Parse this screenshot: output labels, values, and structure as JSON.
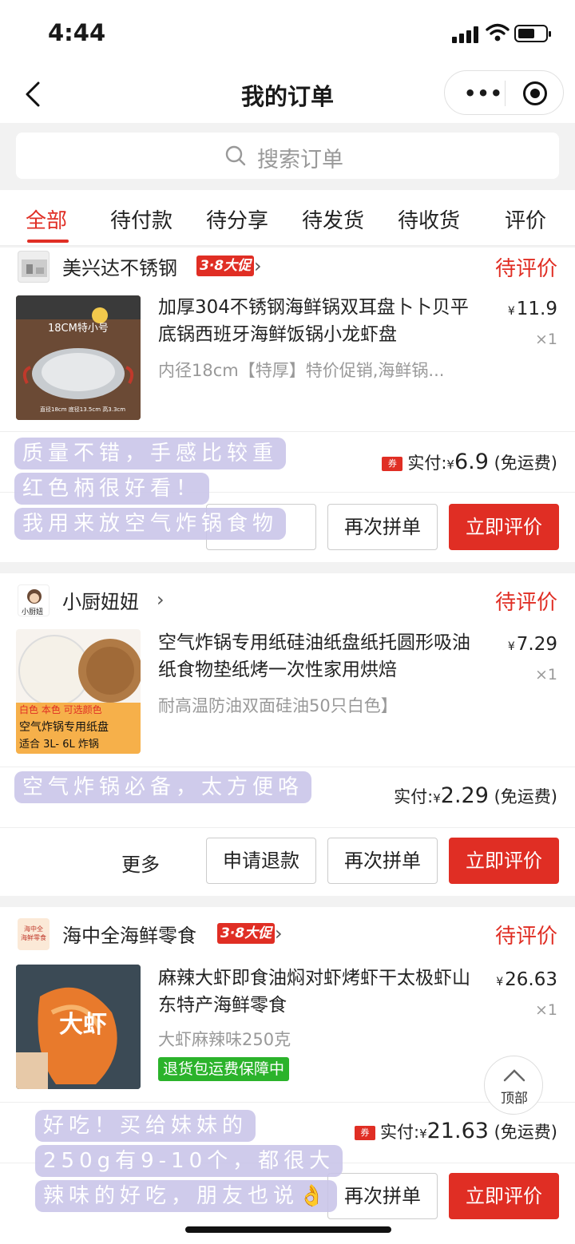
{
  "status_bar": {
    "time": "4:44"
  },
  "nav": {
    "title": "我的订单"
  },
  "search": {
    "placeholder": "搜索订单"
  },
  "tabs": [
    {
      "label": "全部"
    },
    {
      "label": "待付款"
    },
    {
      "label": "待分享"
    },
    {
      "label": "待发货"
    },
    {
      "label": "待收货"
    },
    {
      "label": "评价"
    }
  ],
  "orders": [
    {
      "shop": "美兴达不锈钢",
      "promo": "3·8大促",
      "status": "待评价",
      "product": "加厚304不锈钢海鲜锅双耳盘卜卜贝平底锅西班牙海鲜饭锅小龙虾盘",
      "spec": "内径18cm【特厚】特价促销,海鲜锅...",
      "price": "11.9",
      "qty": "×1",
      "paid_label": "实付:",
      "paid_amount": "6.9",
      "shipping": "(免运费)",
      "coupon": "券",
      "image_text": "18CM特小号",
      "image_caption": "直径18cm 底径13.5cm 高3.3cm",
      "buttons": [
        "再次拼单",
        "立即评价"
      ],
      "review_overlay": [
        "质量不错，手感比较重",
        "红色柄很好看！",
        "我用来放空气炸锅食物"
      ]
    },
    {
      "shop": "小厨妞妞",
      "status": "待评价",
      "product": "空气炸锅专用纸硅油纸盘纸托圆形吸油纸食物垫纸烤一次性家用烘焙",
      "spec": "耐高温防油双面硅油50只白色】",
      "price": "7.29",
      "qty": "×1",
      "paid_label": "实付:",
      "paid_amount": "2.29",
      "shipping": "(免运费)",
      "logo_text": "小厨妞",
      "image_lines": [
        "白色 本色 可选颜色",
        "空气炸锅专用纸盘",
        "适合 3L- 6L 炸锅"
      ],
      "more": "更多",
      "buttons": [
        "申请退款",
        "再次拼单",
        "立即评价"
      ],
      "review_overlay": [
        "空气炸锅必备，太方便咯"
      ]
    },
    {
      "shop": "海中全海鲜零食",
      "promo": "3·8大促",
      "status": "待评价",
      "product": "麻辣大虾即食油焖对虾烤虾干太极虾山东特产海鲜零食",
      "spec": "大虾麻辣味250克",
      "tag": "退货包运费保障中",
      "price": "26.63",
      "qty": "×1",
      "paid_label": "实付:",
      "paid_amount": "21.63",
      "shipping": "(免运费)",
      "coupon": "券",
      "logo_text": "海中全 海鲜零食",
      "image_text": "大虾",
      "buttons": [
        "再次拼单",
        "立即评价"
      ],
      "review_overlay": [
        "好吃！买给妹妹的",
        "250g有9-10个，都很大",
        "辣味的好吃，朋友也说👌"
      ]
    }
  ],
  "currency": "¥",
  "back_to_top": "顶部"
}
